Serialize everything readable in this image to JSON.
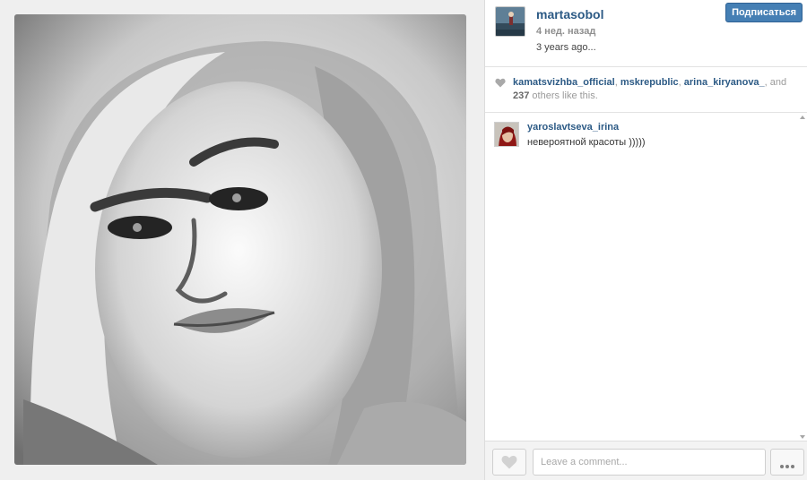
{
  "post": {
    "username": "martasobol",
    "timestamp": "4 нед. назад",
    "caption": "3 years ago...",
    "follow_label": "Подписаться",
    "photo_icon": "portrait-photo"
  },
  "likes": {
    "users": [
      "kamatsvizhba_official",
      "mskrepublic",
      "arina_kiryanova_"
    ],
    "prefix": "and",
    "count": "237",
    "suffix": "others like this."
  },
  "comments": [
    {
      "username": "yaroslavtseva_irina",
      "text": "невероятной красоты )))))"
    }
  ],
  "footer": {
    "comment_placeholder": "Leave a comment..."
  },
  "colors": {
    "link": "#2c5a85",
    "follow_button": "#457fb4"
  },
  "icons": [
    "heart-icon",
    "like-heart-icon",
    "more-dots-icon"
  ]
}
